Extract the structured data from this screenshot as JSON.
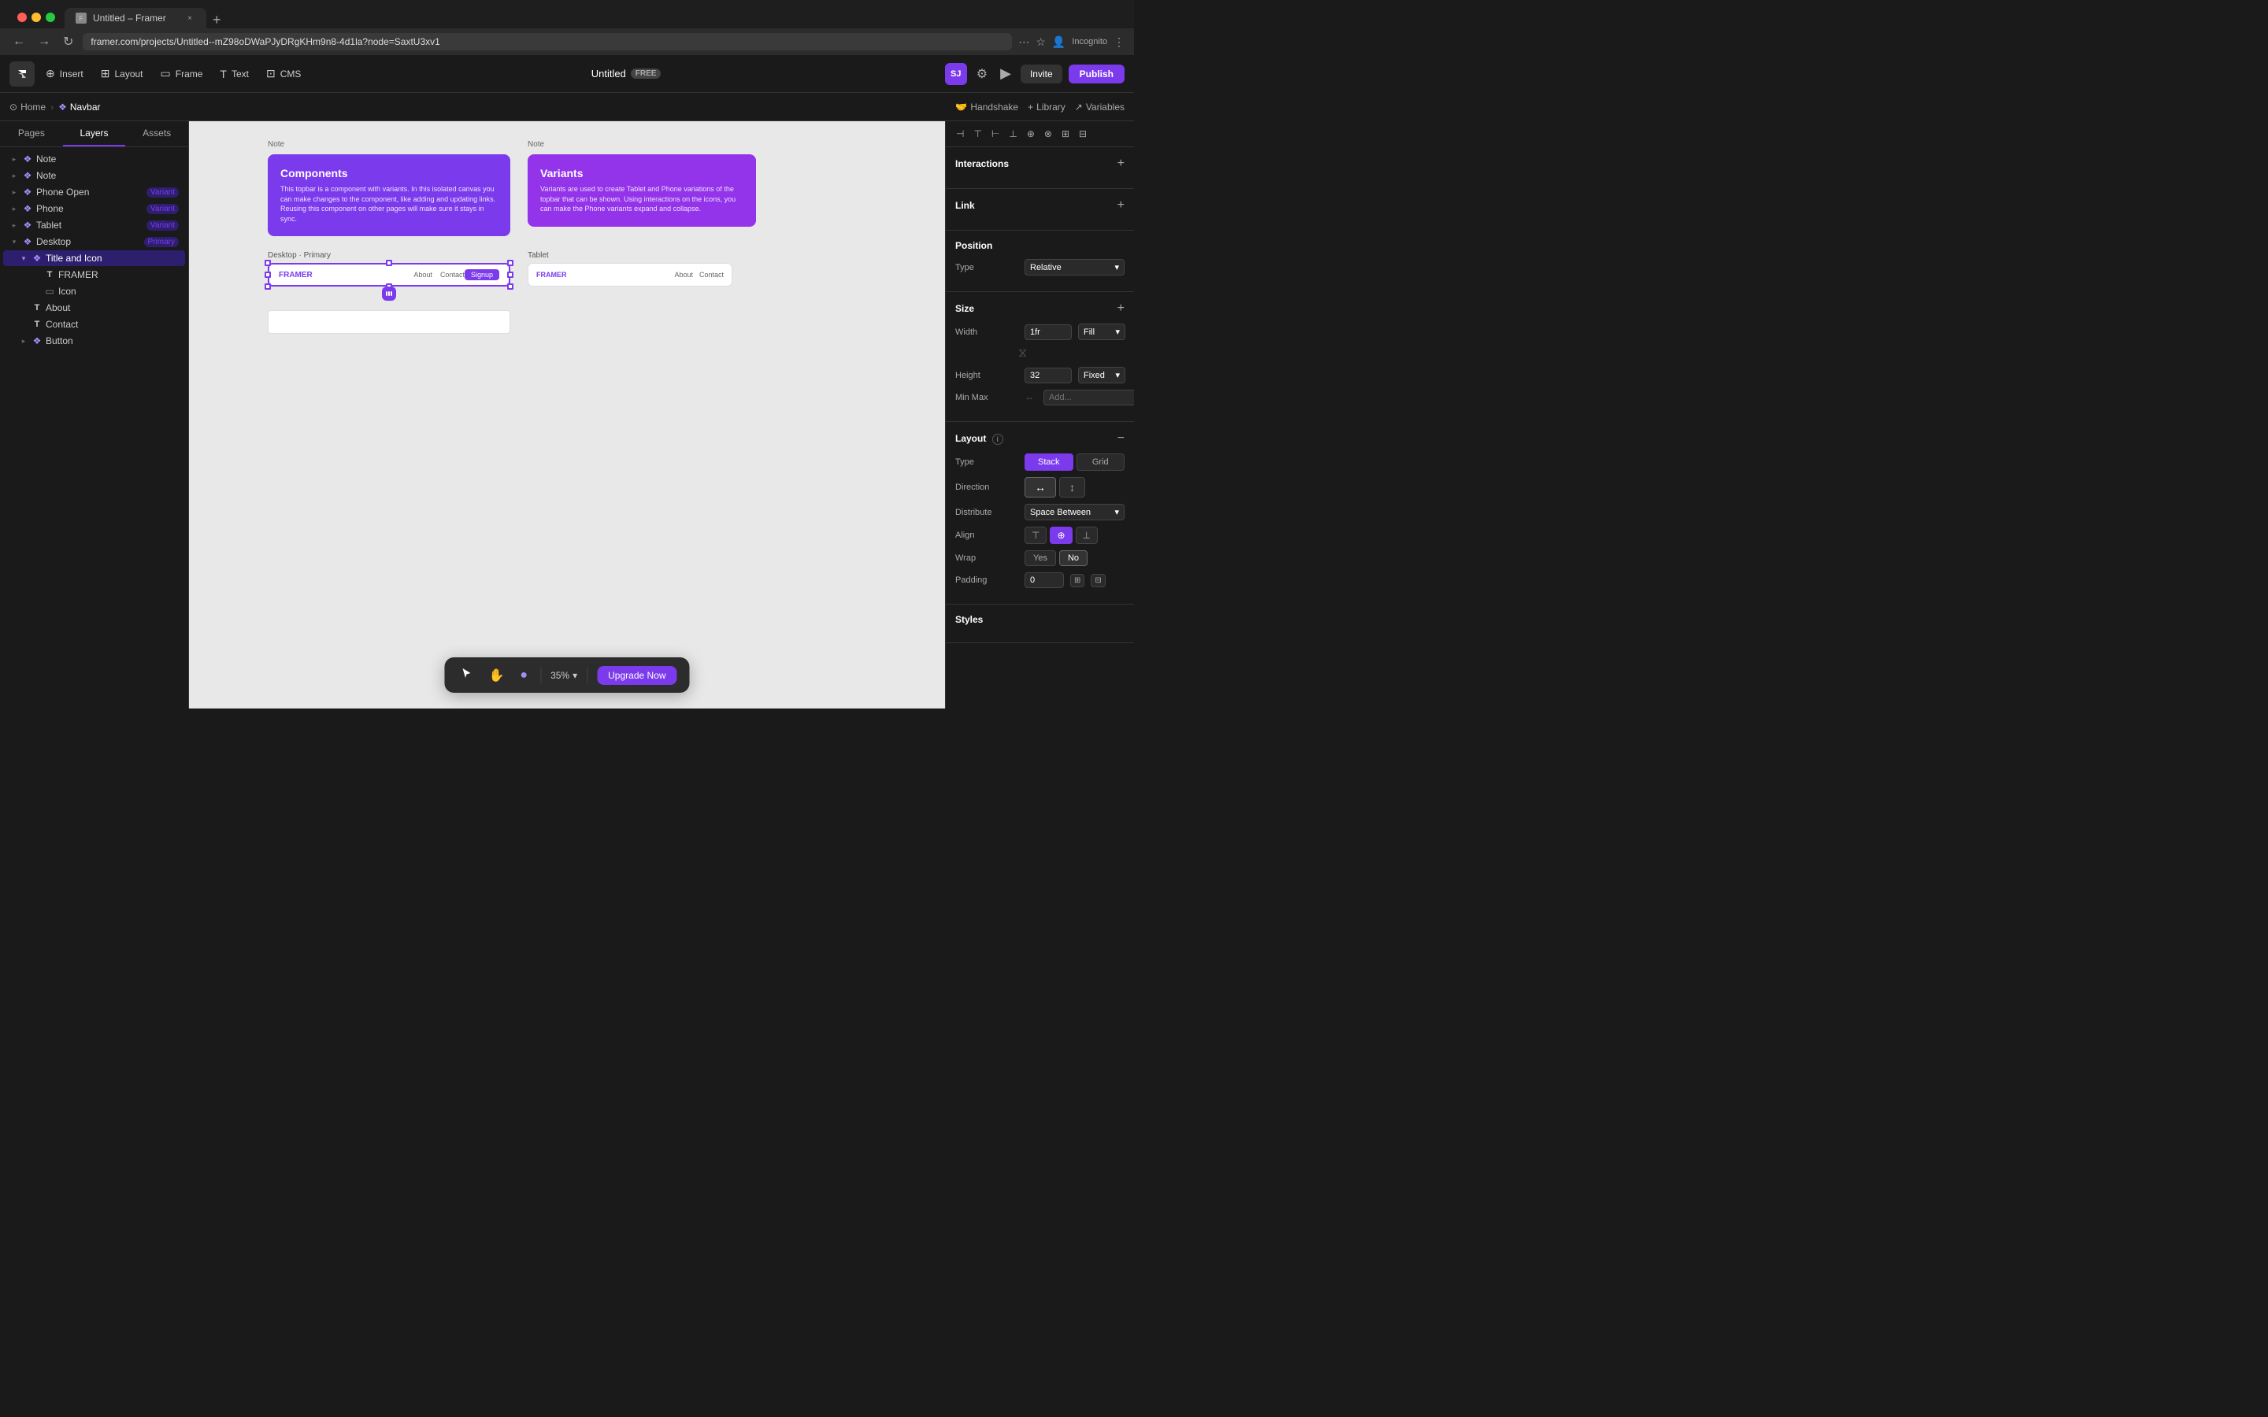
{
  "browser": {
    "tab_title": "Untitled – Framer",
    "url": "framer.com/projects/Untitled--mZ98oDWaPJyDRgKHm9n8-4d1la?node=SaxtU3xv1",
    "new_tab_icon": "+",
    "back_icon": "←",
    "forward_icon": "→",
    "refresh_icon": "↻",
    "dots_icon": "⋯",
    "incognito_label": "Incognito"
  },
  "header": {
    "logo_icon": "◈",
    "tools": [
      {
        "id": "insert",
        "label": "Insert",
        "icon": "+"
      },
      {
        "id": "layout",
        "label": "Layout",
        "icon": "⊞"
      },
      {
        "id": "frame",
        "label": "Frame",
        "icon": "▭"
      },
      {
        "id": "text",
        "label": "Text",
        "icon": "T"
      },
      {
        "id": "cms",
        "label": "CMS",
        "icon": "⊡"
      }
    ],
    "project_title": "Untitled",
    "project_badge": "FREE",
    "avatar": "SJ",
    "settings_icon": "⚙",
    "play_icon": "▶",
    "invite_label": "Invite",
    "publish_label": "Publish"
  },
  "sub_header": {
    "home_icon": "⊙",
    "home_label": "Home",
    "sep": "›",
    "navbar_icon": "❖",
    "navbar_label": "Navbar",
    "handshake_label": "Handshake",
    "library_label": "Library",
    "variables_label": "Variables"
  },
  "left_panel": {
    "tabs": [
      "Pages",
      "Layers",
      "Assets"
    ],
    "active_tab": "Layers",
    "layers": [
      {
        "id": "note1",
        "label": "Note",
        "indent": 0,
        "type": "component",
        "icon": "❖",
        "badge": ""
      },
      {
        "id": "note2",
        "label": "Note",
        "indent": 0,
        "type": "component",
        "icon": "❖",
        "badge": ""
      },
      {
        "id": "phone-open",
        "label": "Phone Open",
        "indent": 0,
        "type": "component",
        "icon": "❖",
        "badge": "Variant"
      },
      {
        "id": "phone",
        "label": "Phone",
        "indent": 0,
        "type": "component",
        "icon": "❖",
        "badge": "Variant"
      },
      {
        "id": "tablet",
        "label": "Tablet",
        "indent": 0,
        "type": "component",
        "icon": "❖",
        "badge": "Variant"
      },
      {
        "id": "desktop",
        "label": "Desktop",
        "indent": 0,
        "type": "component",
        "icon": "❖",
        "badge": "Primary"
      },
      {
        "id": "title-icon",
        "label": "Title and Icon",
        "indent": 1,
        "type": "component",
        "icon": "❖",
        "badge": "",
        "selected": true,
        "expanded": true
      },
      {
        "id": "framer",
        "label": "FRAMER",
        "indent": 2,
        "type": "text",
        "icon": "T",
        "badge": ""
      },
      {
        "id": "icon",
        "label": "Icon",
        "indent": 2,
        "type": "frame",
        "icon": "▭",
        "badge": ""
      },
      {
        "id": "about",
        "label": "About",
        "indent": 1,
        "type": "text",
        "icon": "T",
        "badge": ""
      },
      {
        "id": "contact",
        "label": "Contact",
        "indent": 1,
        "type": "text",
        "icon": "T",
        "badge": ""
      },
      {
        "id": "button",
        "label": "Button",
        "indent": 1,
        "type": "component",
        "icon": "❖",
        "badge": ""
      }
    ]
  },
  "canvas": {
    "note1": {
      "label": "Note",
      "title": "Components",
      "text": "This topbar is a component with variants. In this isolated canvas you can make changes to the component, like adding and updating links. Reusing this component on other pages will make sure it stays in sync."
    },
    "note2": {
      "label": "Note",
      "title": "Variants",
      "text": "Variants are used to create Tablet and Phone variations of the topbar that can be shown. Using interactions on the icons, you can make the Phone variants expand and collapse."
    },
    "desktop_label": "Desktop · Primary",
    "tablet_label": "Tablet",
    "navbar": {
      "logo": "FRAMER",
      "links": [
        "About",
        "Contact"
      ],
      "signup": "Signup"
    }
  },
  "bottom_toolbar": {
    "cursor_icon": "↖",
    "hand_icon": "✋",
    "comment_icon": "●",
    "zoom_label": "35%",
    "upgrade_label": "Upgrade Now"
  },
  "right_panel": {
    "align_icons": [
      "⊢",
      "⊤",
      "⊣",
      "⊥",
      "⊕",
      "⊗",
      "⊞",
      "⊟"
    ],
    "sections": {
      "interactions": {
        "title": "Interactions",
        "add_icon": "+"
      },
      "link": {
        "title": "Link",
        "add_icon": "+"
      },
      "position": {
        "title": "Position",
        "type_label": "Type",
        "type_value": "Relative"
      },
      "size": {
        "title": "Size",
        "add_icon": "+",
        "width_label": "Width",
        "width_value": "1fr",
        "width_fill": "Fill",
        "height_label": "Height",
        "height_value": "32",
        "height_fill": "Fixed",
        "min_max_label": "Min Max",
        "min_max_placeholder": "Add..."
      },
      "layout": {
        "title": "Layout",
        "remove_icon": "−",
        "type_label": "Type",
        "type_stack": "Stack",
        "type_grid": "Grid",
        "direction_label": "Direction",
        "distribute_label": "Distribute",
        "distribute_value": "Space Between",
        "align_label": "Align",
        "wrap_label": "Wrap",
        "wrap_yes": "Yes",
        "wrap_no": "No",
        "padding_label": "Padding",
        "padding_value": "0"
      },
      "styles": {
        "title": "Styles"
      }
    }
  }
}
